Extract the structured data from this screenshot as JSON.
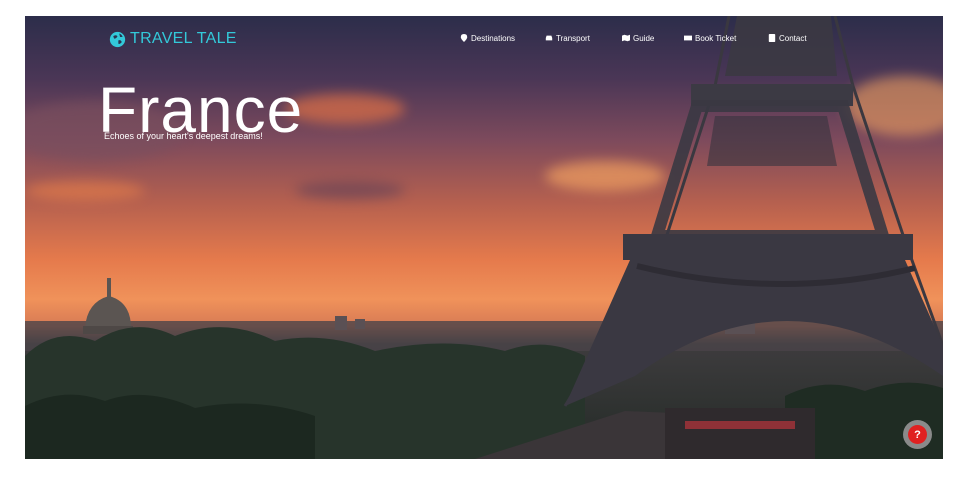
{
  "brand": {
    "name": "TRAVEL TALE",
    "icon": "globe-icon",
    "color": "#33c9d9"
  },
  "nav": [
    {
      "label": "Destinations",
      "icon": "map-pin-icon"
    },
    {
      "label": "Transport",
      "icon": "car-icon"
    },
    {
      "label": "Guide",
      "icon": "map-icon"
    },
    {
      "label": "Book Ticket",
      "icon": "ticket-icon"
    },
    {
      "label": "Contact",
      "icon": "contact-icon"
    }
  ],
  "hero": {
    "title": "France",
    "subtitle": "Echoes of your heart's deepest dreams!"
  },
  "help": {
    "label": "?",
    "color": "#e02020"
  }
}
